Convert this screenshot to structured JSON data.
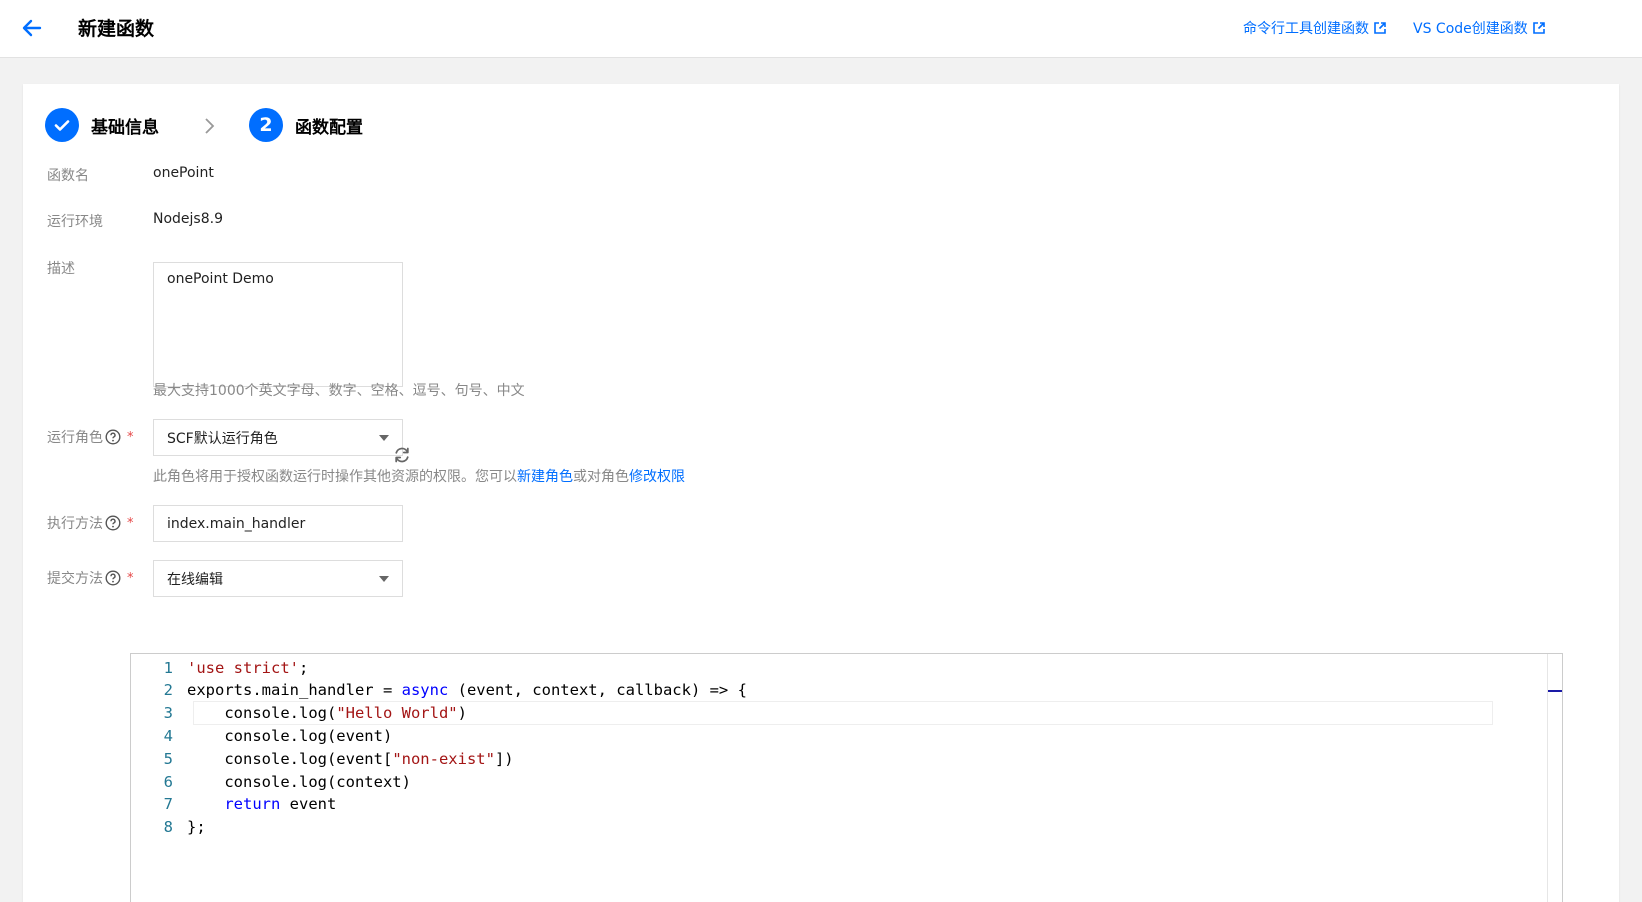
{
  "header": {
    "title": "新建函数",
    "links": [
      "命令行工具创建函数",
      "VS Code创建函数"
    ]
  },
  "steps": [
    {
      "index": "1",
      "label": "基础信息",
      "status": "done"
    },
    {
      "index": "2",
      "label": "函数配置",
      "status": "active"
    }
  ],
  "form": {
    "function_name": {
      "label": "函数名",
      "value": "onePoint"
    },
    "runtime": {
      "label": "运行环境",
      "value": "Nodejs8.9"
    },
    "description": {
      "label": "描述",
      "value": "onePoint Demo",
      "hint": "最大支持1000个英文字母、数字、空格、逗号、句号、中文"
    },
    "role": {
      "label": "运行角色",
      "value": "SCF默认运行角色",
      "hint_prefix": "此角色将用于授权函数运行时操作其他资源的权限。您可以",
      "hint_link1": "新建角色",
      "hint_middle": "或对角色",
      "hint_link2": "修改权限"
    },
    "handler": {
      "label": "执行方法",
      "value": "index.main_handler"
    },
    "submit_method": {
      "label": "提交方法",
      "value": "在线编辑"
    },
    "required_mark": "*"
  },
  "editor": {
    "lines": [
      {
        "n": "1",
        "tokens": [
          {
            "t": "'use strict'",
            "c": "str"
          },
          {
            "t": ";",
            "c": ""
          }
        ]
      },
      {
        "n": "2",
        "tokens": [
          {
            "t": "exports.main_handler = ",
            "c": ""
          },
          {
            "t": "async",
            "c": "kw"
          },
          {
            "t": " (event, context, callback) => {",
            "c": ""
          }
        ]
      },
      {
        "n": "3",
        "tokens": [
          {
            "t": "    console.log(",
            "c": ""
          },
          {
            "t": "\"Hello World\"",
            "c": "str"
          },
          {
            "t": ")",
            "c": ""
          }
        ]
      },
      {
        "n": "4",
        "tokens": [
          {
            "t": "    console.log(event)",
            "c": ""
          }
        ]
      },
      {
        "n": "5",
        "tokens": [
          {
            "t": "    console.log(event[",
            "c": ""
          },
          {
            "t": "\"non-exist\"",
            "c": "str"
          },
          {
            "t": "])",
            "c": ""
          }
        ]
      },
      {
        "n": "6",
        "tokens": [
          {
            "t": "    console.log(context)",
            "c": ""
          }
        ]
      },
      {
        "n": "7",
        "tokens": [
          {
            "t": "    ",
            "c": ""
          },
          {
            "t": "return",
            "c": "kw"
          },
          {
            "t": " event",
            "c": ""
          }
        ]
      },
      {
        "n": "8",
        "tokens": [
          {
            "t": "};",
            "c": ""
          }
        ]
      }
    ],
    "current_line": "3"
  },
  "colors": {
    "primary": "#006eff",
    "required": "#e54545",
    "line_number": "#237893",
    "string": "#a31515",
    "keyword": "#0000ff"
  },
  "icons": [
    "back-arrow-icon",
    "external-link-icon",
    "check-icon",
    "chevron-right-icon",
    "question-circle-icon",
    "refresh-icon",
    "caret-down-icon"
  ]
}
